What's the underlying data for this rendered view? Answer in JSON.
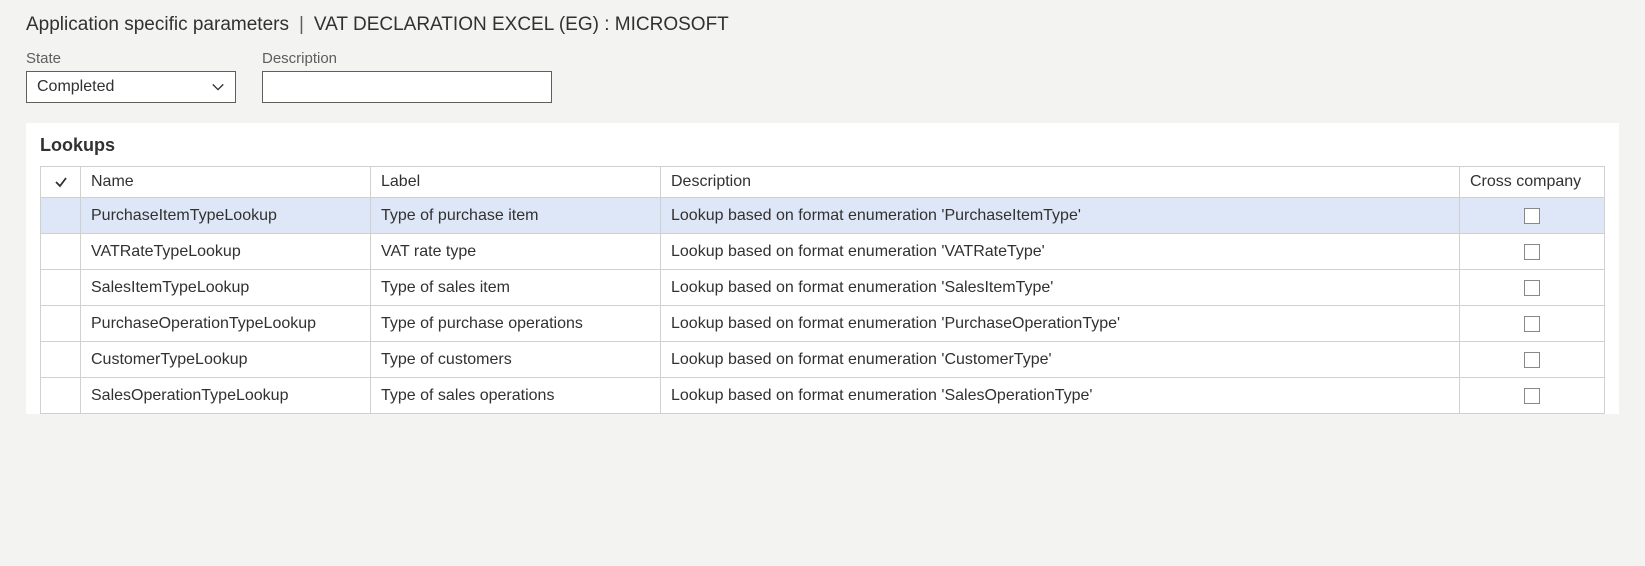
{
  "breadcrumb": {
    "title": "Application specific parameters",
    "context": "VAT DECLARATION EXCEL (EG) : MICROSOFT"
  },
  "fields": {
    "state_label": "State",
    "state_value": "Completed",
    "description_label": "Description",
    "description_value": ""
  },
  "panel": {
    "title": "Lookups"
  },
  "grid": {
    "headers": {
      "name": "Name",
      "label": "Label",
      "description": "Description",
      "cross_company": "Cross company"
    },
    "rows": [
      {
        "name": "PurchaseItemTypeLookup",
        "label": "Type of purchase item",
        "description": "Lookup based on format enumeration 'PurchaseItemType'",
        "cross_company": false,
        "selected": true
      },
      {
        "name": "VATRateTypeLookup",
        "label": "VAT rate type",
        "description": "Lookup based on format enumeration 'VATRateType'",
        "cross_company": false,
        "selected": false
      },
      {
        "name": "SalesItemTypeLookup",
        "label": "Type of sales item",
        "description": "Lookup based on format enumeration 'SalesItemType'",
        "cross_company": false,
        "selected": false
      },
      {
        "name": "PurchaseOperationTypeLookup",
        "label": "Type of purchase operations",
        "description": "Lookup based on format enumeration 'PurchaseOperationType'",
        "cross_company": false,
        "selected": false
      },
      {
        "name": "CustomerTypeLookup",
        "label": "Type of customers",
        "description": "Lookup based on format enumeration 'CustomerType'",
        "cross_company": false,
        "selected": false
      },
      {
        "name": "SalesOperationTypeLookup",
        "label": "Type of sales operations",
        "description": "Lookup based on format enumeration 'SalesOperationType'",
        "cross_company": false,
        "selected": false
      }
    ]
  }
}
